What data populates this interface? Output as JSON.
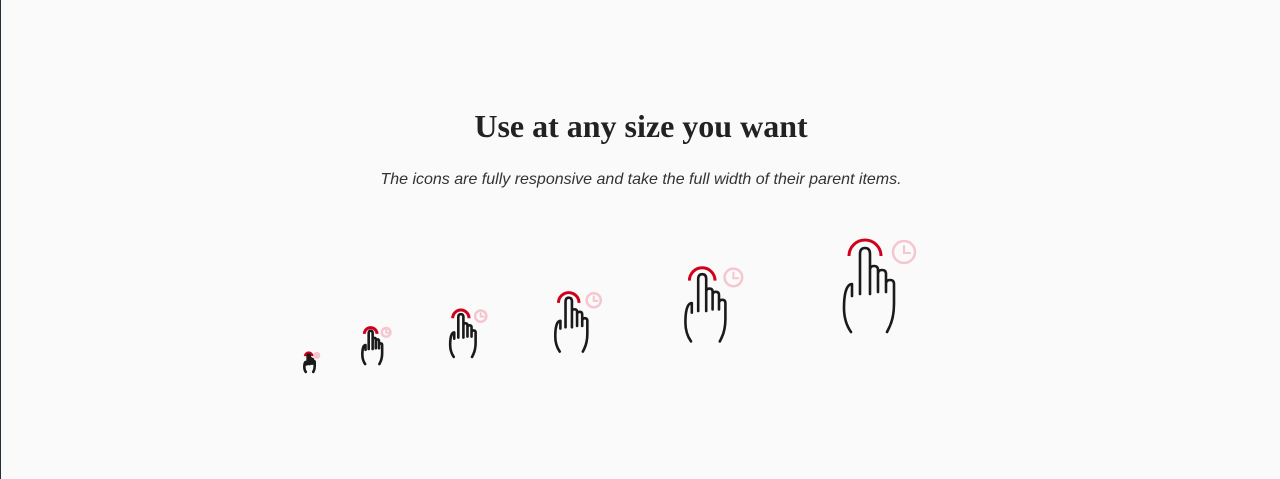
{
  "section": {
    "title": "Use at any size you want",
    "subtitle": "The icons are fully responsive and take the full width of their parent items."
  },
  "icon": {
    "name": "tap-and-hold",
    "accent_color": "#d0021b",
    "accent_light_color": "#f5c6cf",
    "stroke_color": "#1a1a1a",
    "count": 6
  }
}
